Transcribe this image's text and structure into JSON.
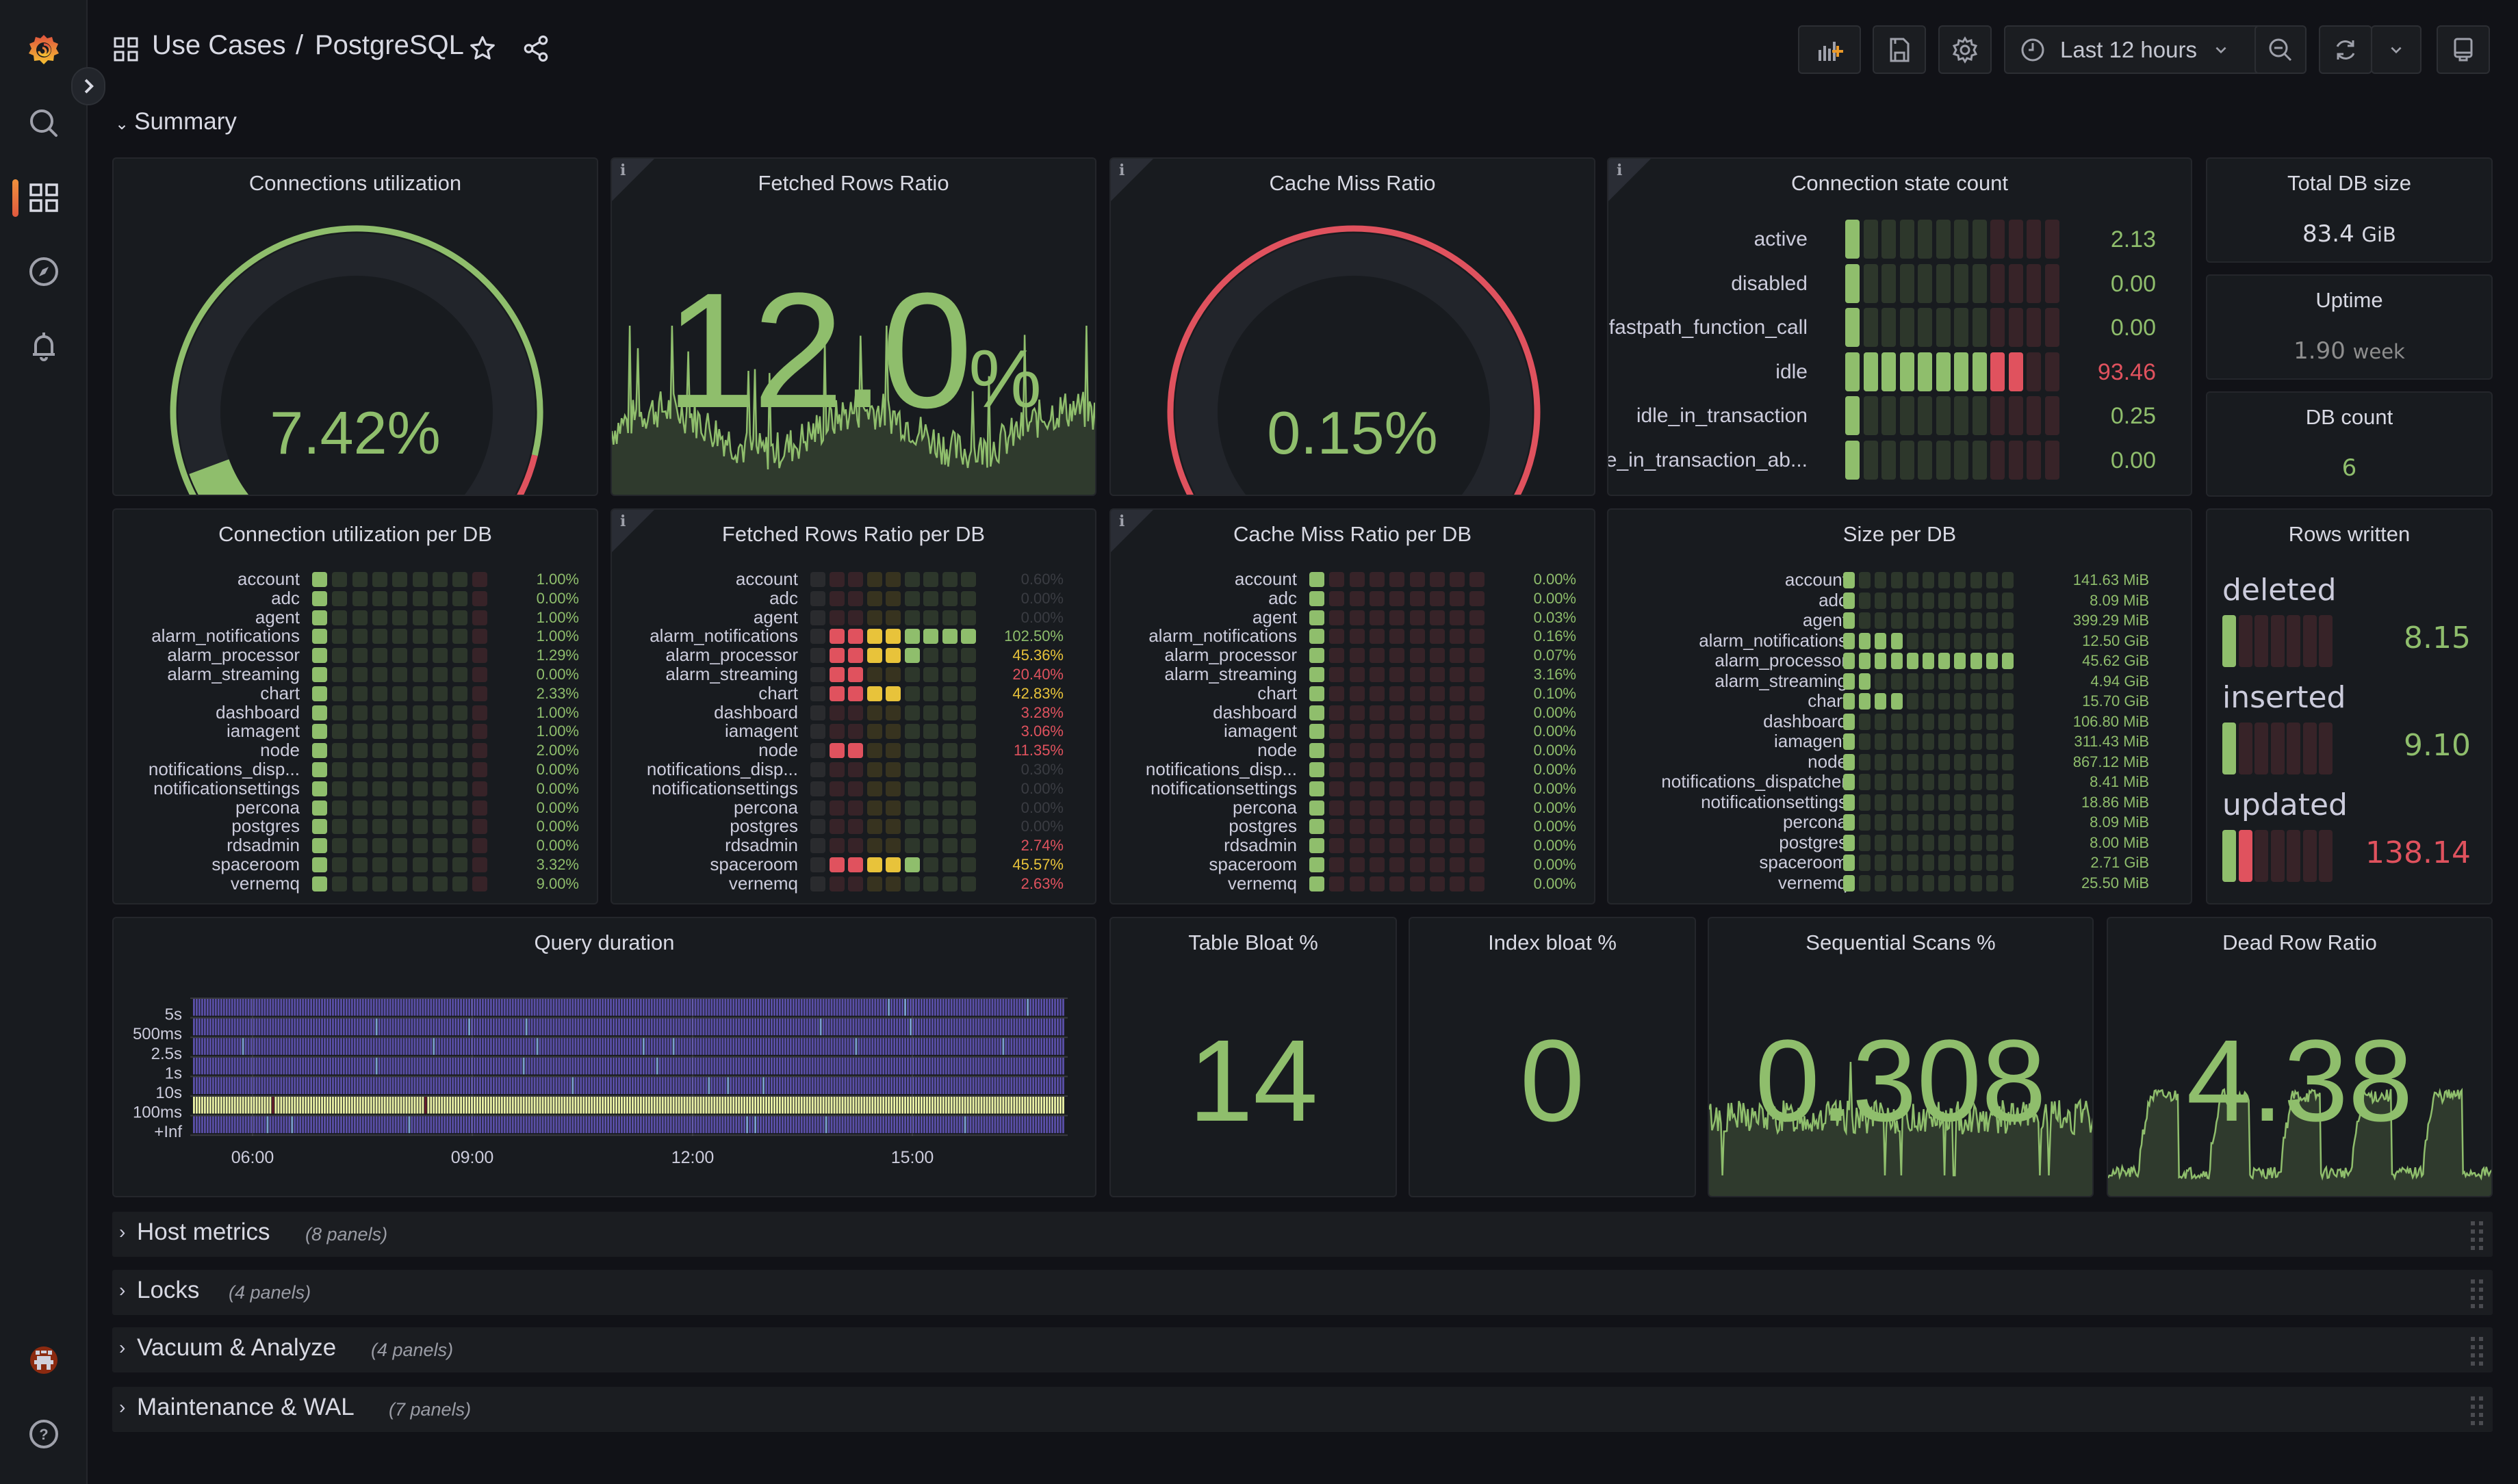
{
  "header": {
    "breadcrumb_parent": "Use Cases",
    "breadcrumb_sep": "/",
    "dashboard_title": "PostgreSQL",
    "time_range": "Last 12 hours"
  },
  "sidebar": {
    "items": [
      {
        "name": "grafana-logo-icon"
      },
      {
        "name": "search-icon"
      },
      {
        "name": "dashboards-icon",
        "active": true
      },
      {
        "name": "explore-compass-icon"
      },
      {
        "name": "alerting-bell-icon"
      },
      {
        "name": "user-avatar"
      },
      {
        "name": "help-icon"
      }
    ]
  },
  "toolbar": {
    "add_panel": "add-panel-icon",
    "save": "save-icon",
    "settings": "settings-gear-icon",
    "time_icon": "clock-icon",
    "zoom_out": "zoom-out-icon",
    "refresh": "refresh-icon",
    "tv_mode": "tv-monitor-icon"
  },
  "summary_row": {
    "title": "Summary",
    "expanded": true
  },
  "colors": {
    "green": "#8fbe6c",
    "red": "#e0525e",
    "yellow": "#e8c33a",
    "orange_accent": "#f0913d",
    "heatmap_low": "#5a4fa8",
    "heatmap_high": "#e9f0a4"
  },
  "panels": {
    "connections_utilization": {
      "title": "Connections utilization",
      "value": "7.42%",
      "fraction": 0.0742,
      "thresholds": [
        {
          "color": "green",
          "from": 0
        },
        {
          "color": "red",
          "from": 0.9
        }
      ]
    },
    "fetched_rows_ratio": {
      "title": "Fetched Rows Ratio",
      "value": "12.0",
      "unit": "%",
      "has_info": true
    },
    "cache_miss_ratio": {
      "title": "Cache Miss Ratio",
      "value": "0.15%",
      "fraction": 0.0015,
      "has_info": true,
      "thresholds": [
        {
          "color": "green",
          "from": 0
        },
        {
          "color": "red",
          "from": 0.05
        }
      ]
    },
    "connection_state_count": {
      "title": "Connection state count",
      "has_info": true,
      "max": 120,
      "rows": [
        {
          "label": "active",
          "value": "2.13",
          "num": 2.13,
          "color": "green"
        },
        {
          "label": "disabled",
          "value": "0.00",
          "num": 0,
          "color": "green"
        },
        {
          "label": "fastpath_function_call",
          "value": "0.00",
          "num": 0,
          "color": "green"
        },
        {
          "label": "idle",
          "value": "93.46",
          "num": 93.46,
          "color": "red"
        },
        {
          "label": "idle_in_transaction",
          "value": "0.25",
          "num": 0.25,
          "color": "green"
        },
        {
          "label": "idle_in_transaction_ab...",
          "value": "0.00",
          "num": 0,
          "color": "green"
        }
      ]
    },
    "total_db_size": {
      "title": "Total DB size",
      "value": "83.4",
      "unit": "GiB"
    },
    "uptime": {
      "title": "Uptime",
      "value": "1.90",
      "unit": "week"
    },
    "db_count": {
      "title": "DB count",
      "value": "6"
    },
    "connection_utilization_per_db": {
      "title": "Connection utilization per DB",
      "rows": [
        {
          "label": "account",
          "value": "1.00%"
        },
        {
          "label": "adc",
          "value": "0.00%"
        },
        {
          "label": "agent",
          "value": "1.00%"
        },
        {
          "label": "alarm_notifications",
          "value": "1.00%"
        },
        {
          "label": "alarm_processor",
          "value": "1.29%"
        },
        {
          "label": "alarm_streaming",
          "value": "0.00%"
        },
        {
          "label": "chart",
          "value": "2.33%"
        },
        {
          "label": "dashboard",
          "value": "1.00%"
        },
        {
          "label": "iamagent",
          "value": "1.00%"
        },
        {
          "label": "node",
          "value": "2.00%"
        },
        {
          "label": "notifications_disp...",
          "value": "0.00%"
        },
        {
          "label": "notificationsettings",
          "value": "0.00%"
        },
        {
          "label": "percona",
          "value": "0.00%"
        },
        {
          "label": "postgres",
          "value": "0.00%"
        },
        {
          "label": "rdsadmin",
          "value": "0.00%"
        },
        {
          "label": "spaceroom",
          "value": "3.32%"
        },
        {
          "label": "vernemq",
          "value": "9.00%"
        }
      ]
    },
    "fetched_rows_ratio_per_db": {
      "title": "Fetched Rows Ratio per DB",
      "has_info": true,
      "rows": [
        {
          "label": "account",
          "value": "0.60%",
          "lit": 0,
          "color": "dim"
        },
        {
          "label": "adc",
          "value": "0.00%",
          "lit": 0,
          "color": "dim"
        },
        {
          "label": "agent",
          "value": "0.00%",
          "lit": 0,
          "color": "dim"
        },
        {
          "label": "alarm_notifications",
          "value": "102.50%",
          "lit": 9,
          "color": "green"
        },
        {
          "label": "alarm_processor",
          "value": "45.36%",
          "lit": 5,
          "color": "yellow"
        },
        {
          "label": "alarm_streaming",
          "value": "20.40%",
          "lit": 2,
          "color": "red"
        },
        {
          "label": "chart",
          "value": "42.83%",
          "lit": 4,
          "color": "yellow"
        },
        {
          "label": "dashboard",
          "value": "3.28%",
          "lit": 0,
          "color": "red"
        },
        {
          "label": "iamagent",
          "value": "3.06%",
          "lit": 0,
          "color": "red"
        },
        {
          "label": "node",
          "value": "11.35%",
          "lit": 2,
          "color": "red"
        },
        {
          "label": "notifications_disp...",
          "value": "0.30%",
          "lit": 0,
          "color": "dim"
        },
        {
          "label": "notificationsettings",
          "value": "0.00%",
          "lit": 0,
          "color": "dim"
        },
        {
          "label": "percona",
          "value": "0.00%",
          "lit": 0,
          "color": "dim"
        },
        {
          "label": "postgres",
          "value": "0.00%",
          "lit": 0,
          "color": "dim"
        },
        {
          "label": "rdsadmin",
          "value": "2.74%",
          "lit": 0,
          "color": "red"
        },
        {
          "label": "spaceroom",
          "value": "45.57%",
          "lit": 5,
          "color": "yellow"
        },
        {
          "label": "vernemq",
          "value": "2.63%",
          "lit": 0,
          "color": "red"
        }
      ]
    },
    "cache_miss_ratio_per_db": {
      "title": "Cache Miss Ratio per DB",
      "has_info": true,
      "rows": [
        {
          "label": "account",
          "value": "0.00%"
        },
        {
          "label": "adc",
          "value": "0.00%"
        },
        {
          "label": "agent",
          "value": "0.03%"
        },
        {
          "label": "alarm_notifications",
          "value": "0.16%"
        },
        {
          "label": "alarm_processor",
          "value": "0.07%"
        },
        {
          "label": "alarm_streaming",
          "value": "3.16%"
        },
        {
          "label": "chart",
          "value": "0.10%"
        },
        {
          "label": "dashboard",
          "value": "0.00%"
        },
        {
          "label": "iamagent",
          "value": "0.00%"
        },
        {
          "label": "node",
          "value": "0.00%"
        },
        {
          "label": "notifications_disp...",
          "value": "0.00%"
        },
        {
          "label": "notificationsettings",
          "value": "0.00%"
        },
        {
          "label": "percona",
          "value": "0.00%"
        },
        {
          "label": "postgres",
          "value": "0.00%"
        },
        {
          "label": "rdsadmin",
          "value": "0.00%"
        },
        {
          "label": "spaceroom",
          "value": "0.00%"
        },
        {
          "label": "vernemq",
          "value": "0.00%"
        }
      ]
    },
    "size_per_db": {
      "title": "Size per DB",
      "rows": [
        {
          "label": "account",
          "value": "141.63 MiB",
          "lit": 1
        },
        {
          "label": "adc",
          "value": "8.09 MiB",
          "lit": 1
        },
        {
          "label": "agent",
          "value": "399.29 MiB",
          "lit": 1
        },
        {
          "label": "alarm_notifications",
          "value": "12.50 GiB",
          "lit": 4
        },
        {
          "label": "alarm_processor",
          "value": "45.62 GiB",
          "lit": 11
        },
        {
          "label": "alarm_streaming",
          "value": "4.94 GiB",
          "lit": 2
        },
        {
          "label": "chart",
          "value": "15.70 GiB",
          "lit": 4
        },
        {
          "label": "dashboard",
          "value": "106.80 MiB",
          "lit": 1
        },
        {
          "label": "iamagent",
          "value": "311.43 MiB",
          "lit": 1
        },
        {
          "label": "node",
          "value": "867.12 MiB",
          "lit": 1
        },
        {
          "label": "notifications_dispatcher",
          "value": "8.41 MiB",
          "lit": 1
        },
        {
          "label": "notificationsettings",
          "value": "18.86 MiB",
          "lit": 1
        },
        {
          "label": "percona",
          "value": "8.09 MiB",
          "lit": 1
        },
        {
          "label": "postgres",
          "value": "8.00 MiB",
          "lit": 1
        },
        {
          "label": "spaceroom",
          "value": "2.71 GiB",
          "lit": 1
        },
        {
          "label": "vernemq",
          "value": "25.50 MiB",
          "lit": 1
        }
      ]
    },
    "rows_written": {
      "title": "Rows written",
      "rows": [
        {
          "label": "deleted",
          "value": "8.15",
          "lit": 1,
          "color": "green"
        },
        {
          "label": "inserted",
          "value": "9.10",
          "lit": 1,
          "color": "green"
        },
        {
          "label": "updated",
          "value": "138.14",
          "lit": 2,
          "color": "red"
        }
      ]
    },
    "query_duration": {
      "title": "Query duration"
    },
    "table_bloat": {
      "title": "Table Bloat %",
      "value": "14"
    },
    "index_bloat": {
      "title": "Index bloat %",
      "value": "0"
    },
    "sequential_scans": {
      "title": "Sequential Scans %",
      "value": "0.308"
    },
    "dead_row_ratio": {
      "title": "Dead Row Ratio",
      "value": "4.38"
    }
  },
  "chart_data": {
    "type": "heatmap",
    "title": "Query duration",
    "xlabel": "",
    "ylabel": "",
    "x_ticks": [
      "06:00",
      "09:00",
      "12:00",
      "15:00"
    ],
    "y_buckets": [
      "5s",
      "500ms",
      "2.5s",
      "1s",
      "10s",
      "100ms",
      "+Inf"
    ],
    "dominant_bucket": "100ms",
    "legend": "none"
  },
  "collapsed_rows": [
    {
      "title": "Host metrics",
      "count": "(8 panels)"
    },
    {
      "title": "Locks",
      "count": "(4 panels)"
    },
    {
      "title": "Vacuum & Analyze",
      "count": "(4 panels)"
    },
    {
      "title": "Maintenance & WAL",
      "count": "(7 panels)"
    }
  ]
}
